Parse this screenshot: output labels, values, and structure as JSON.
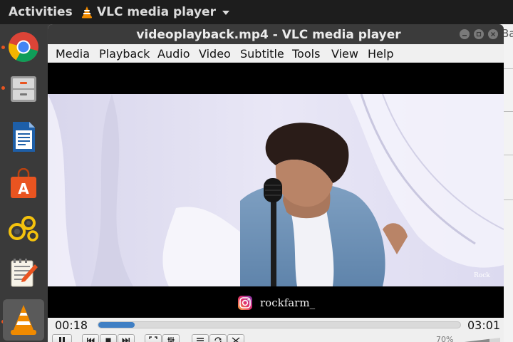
{
  "topbar": {
    "activities": "Activities",
    "app_name": "VLC media player"
  },
  "dock": {
    "items": [
      "chrome",
      "files",
      "writer",
      "software",
      "settings",
      "text-editor",
      "vlc"
    ]
  },
  "window": {
    "title": "videoplayback.mp4 - VLC media player",
    "right_strip_fragment": "Ba"
  },
  "menu": {
    "media": "Media",
    "playback": "Playback",
    "audio": "Audio",
    "video": "Video",
    "subtitle": "Subtitle",
    "tools": "Tools",
    "view": "View",
    "help": "Help"
  },
  "video": {
    "watermark": "Rock",
    "caption": "rockfarm_"
  },
  "controls": {
    "elapsed": "00:18",
    "total": "03:01",
    "progress_fraction": 0.1,
    "volume": "70%"
  },
  "colors": {
    "accent": "#3f7fc4",
    "topbar": "#1d1d1d",
    "dock": "#3a3a3a",
    "running_indicator": "#e95420"
  }
}
